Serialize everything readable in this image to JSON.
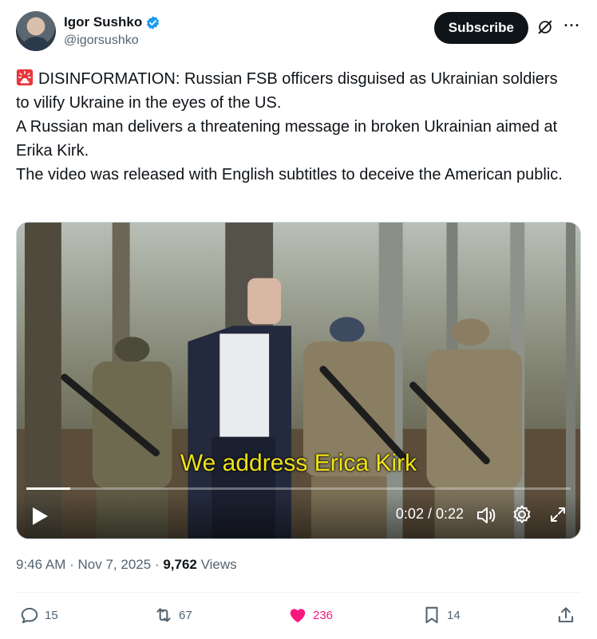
{
  "author": {
    "display_name": "Igor Sushko",
    "handle": "@igorsushko",
    "verified": true
  },
  "header": {
    "subscribe_label": "Subscribe",
    "more_label": "···"
  },
  "post": {
    "lines": [
      "DISINFORMATION: Russian FSB officers disguised as Ukrainian soldiers to vilify Ukraine in the eyes of the US.",
      "A Russian man delivers a threatening message in broken Ukrainian aimed at Erika Kirk.",
      "The video was released with English subtitles to deceive the American public."
    ],
    "lead_emoji": "siren-icon"
  },
  "video": {
    "subtitle": "We address Erica Kirk",
    "time": "0:02 / 0:22",
    "progress_fraction": 0.08
  },
  "meta": {
    "time": "9:46 AM",
    "separator": "·",
    "date": "Nov 7, 2025",
    "views_count": "9,762",
    "views_label": "Views"
  },
  "actions": {
    "replies": "15",
    "reposts": "67",
    "likes": "236",
    "bookmarks": "14"
  },
  "colors": {
    "accent": "#1d9bf0",
    "like": "#f91880",
    "subtitle": "#f2e316",
    "muted": "#536471"
  }
}
